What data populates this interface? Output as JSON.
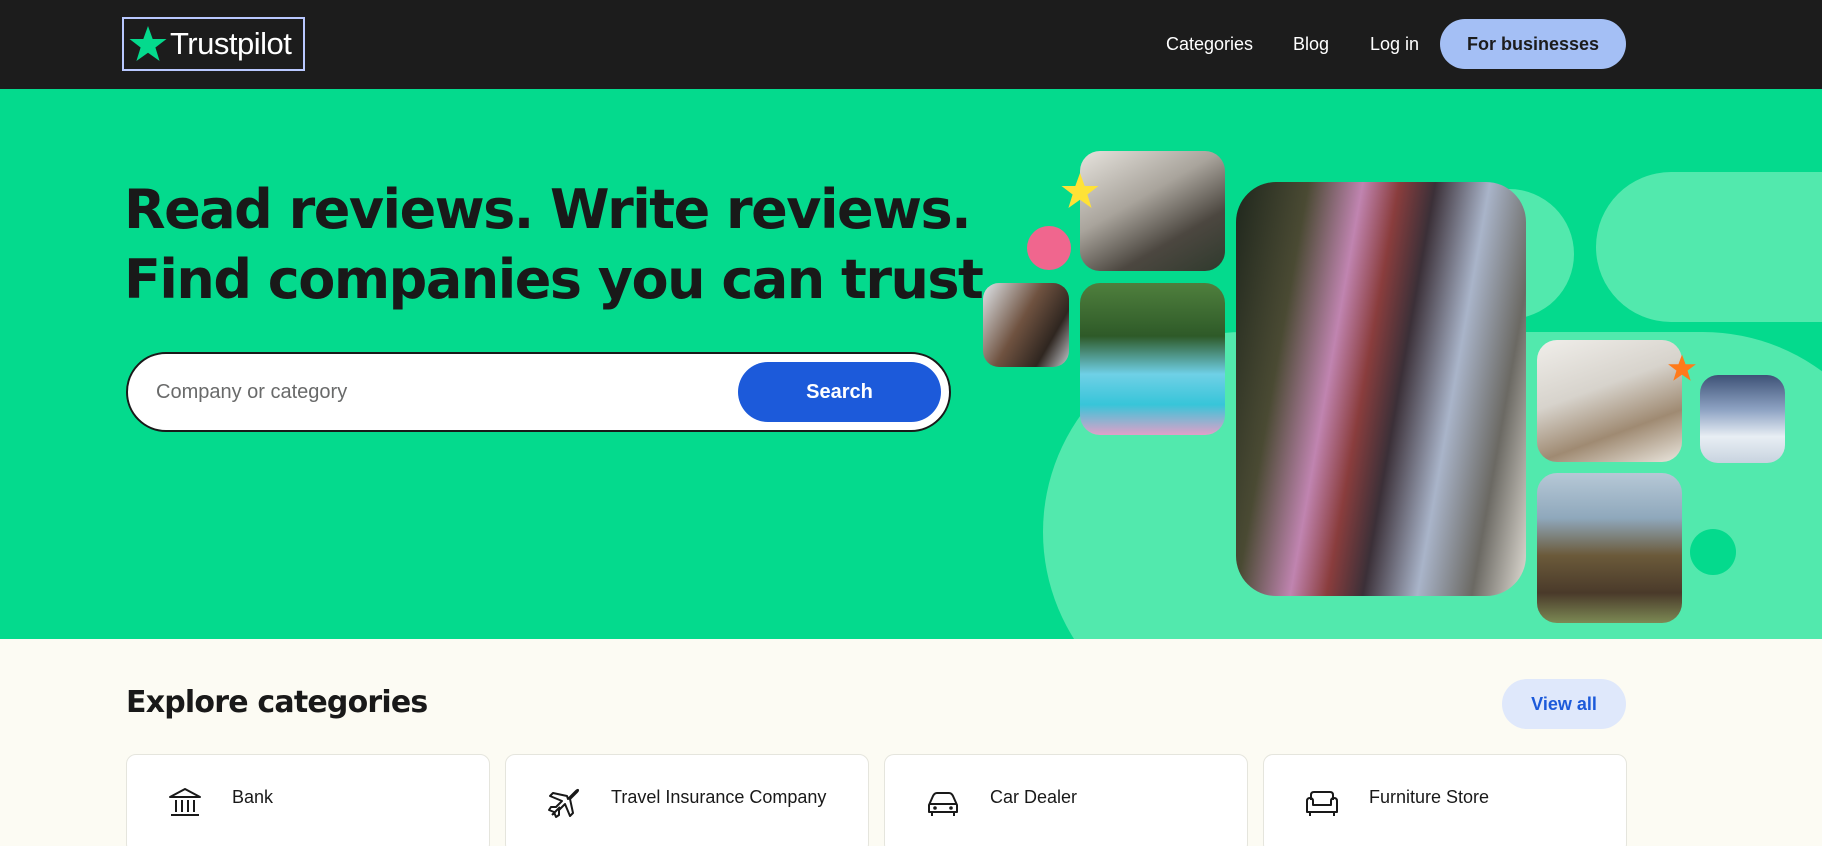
{
  "header": {
    "logo_text": "Trustpilot",
    "nav": {
      "categories": "Categories",
      "blog": "Blog",
      "login": "Log in"
    },
    "business_button": "For businesses"
  },
  "hero": {
    "title_line1": "Read reviews. Write reviews.",
    "title_line2": "Find companies you can trust.",
    "search_placeholder": "Company or category",
    "search_button": "Search"
  },
  "categories": {
    "title": "Explore categories",
    "view_all": "View all",
    "items": [
      {
        "label": "Bank",
        "icon": "bank-icon"
      },
      {
        "label": "Travel Insurance Company",
        "icon": "airplane-icon"
      },
      {
        "label": "Car Dealer",
        "icon": "car-icon"
      },
      {
        "label": "Furniture Store",
        "icon": "sofa-icon"
      }
    ]
  },
  "colors": {
    "header_bg": "#1c1c1c",
    "hero_bg": "#04da8d",
    "hero_blob": "#52e9ad",
    "search_button": "#1c5ada",
    "business_button": "#a4bff5",
    "page_bg": "#fcfbf3"
  }
}
